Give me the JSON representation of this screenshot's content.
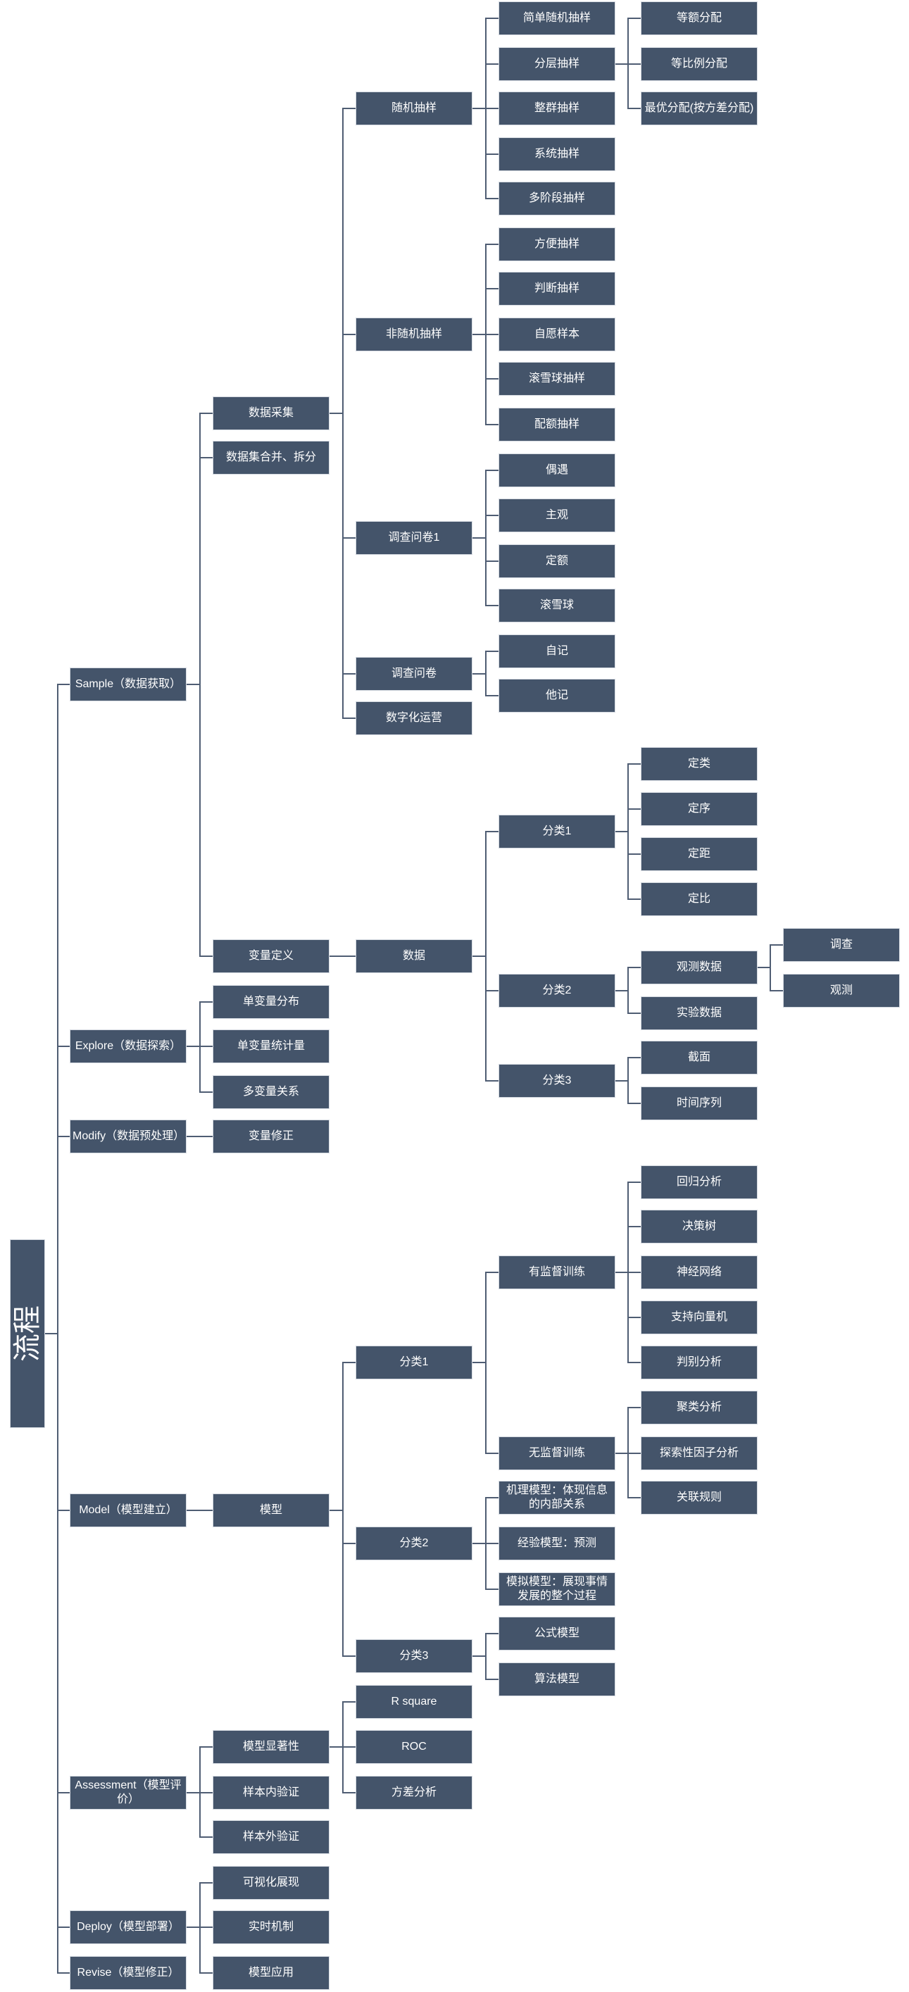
{
  "colors": {
    "box": "#44546A",
    "text": "#FFFFFF",
    "line": "#4F5D73"
  },
  "tree": {
    "label": "流程",
    "children": [
      {
        "label": "Sample（数据获取）",
        "children": [
          {
            "label": "数据采集",
            "children": [
              {
                "label": "随机抽样",
                "children": [
                  {
                    "label": "简单随机抽样"
                  },
                  {
                    "label": "分层抽样",
                    "children": [
                      {
                        "label": "等额分配"
                      },
                      {
                        "label": "等比例分配"
                      },
                      {
                        "label": "最优分配(按方差分配)"
                      }
                    ]
                  },
                  {
                    "label": "整群抽样"
                  },
                  {
                    "label": "系统抽样"
                  },
                  {
                    "label": "多阶段抽样"
                  }
                ]
              },
              {
                "label": "非随机抽样",
                "children": [
                  {
                    "label": "方便抽样"
                  },
                  {
                    "label": "判断抽样"
                  },
                  {
                    "label": "自愿样本"
                  },
                  {
                    "label": "滚雪球抽样"
                  },
                  {
                    "label": "配额抽样"
                  }
                ]
              },
              {
                "label": "调查问卷1",
                "children": [
                  {
                    "label": "偶遇"
                  },
                  {
                    "label": "主观"
                  },
                  {
                    "label": "定额"
                  },
                  {
                    "label": "滚雪球"
                  }
                ]
              },
              {
                "label": "调查问卷",
                "children": [
                  {
                    "label": "自记"
                  },
                  {
                    "label": "他记"
                  }
                ]
              },
              {
                "label": "数字化运营"
              }
            ]
          },
          {
            "label": "数据集合并、拆分"
          },
          {
            "label": "变量定义",
            "children": [
              {
                "label": "数据",
                "children": [
                  {
                    "label": "分类1",
                    "children": [
                      {
                        "label": "定类"
                      },
                      {
                        "label": "定序"
                      },
                      {
                        "label": "定距"
                      },
                      {
                        "label": "定比"
                      }
                    ]
                  },
                  {
                    "label": "分类2",
                    "children": [
                      {
                        "label": "观测数据",
                        "children": [
                          {
                            "label": "调查"
                          },
                          {
                            "label": "观测"
                          }
                        ]
                      },
                      {
                        "label": "实验数据"
                      }
                    ]
                  },
                  {
                    "label": "分类3",
                    "children": [
                      {
                        "label": "截面"
                      },
                      {
                        "label": "时间序列"
                      }
                    ]
                  }
                ]
              }
            ]
          }
        ]
      },
      {
        "label": "Explore（数据探索）",
        "children": [
          {
            "label": "单变量分布"
          },
          {
            "label": "单变量统计量"
          },
          {
            "label": "多变量关系"
          }
        ]
      },
      {
        "label": "Modify（数据预处理）",
        "children": [
          {
            "label": "变量修正"
          }
        ]
      },
      {
        "label": "Model（模型建立）",
        "children": [
          {
            "label": "模型",
            "children": [
              {
                "label": "分类1",
                "children": [
                  {
                    "label": "有监督训练",
                    "children": [
                      {
                        "label": "回归分析"
                      },
                      {
                        "label": "决策树"
                      },
                      {
                        "label": "神经网络"
                      },
                      {
                        "label": "支持向量机"
                      },
                      {
                        "label": "判别分析"
                      }
                    ]
                  },
                  {
                    "label": "无监督训练",
                    "children": [
                      {
                        "label": "聚类分析"
                      },
                      {
                        "label": "探索性因子分析"
                      },
                      {
                        "label": "关联规则"
                      }
                    ]
                  }
                ]
              },
              {
                "label": "分类2",
                "children": [
                  {
                    "label": "机理模型：体现信息的内部关系"
                  },
                  {
                    "label": "经验模型：预测"
                  },
                  {
                    "label": "模拟模型：展现事情发展的整个过程"
                  }
                ]
              },
              {
                "label": "分类3",
                "children": [
                  {
                    "label": "公式模型"
                  },
                  {
                    "label": "算法模型"
                  }
                ]
              }
            ]
          }
        ]
      },
      {
        "label": "Assessment（模型评价）",
        "children": [
          {
            "label": "模型显著性",
            "children": [
              {
                "label": "R square"
              },
              {
                "label": "ROC"
              },
              {
                "label": "方差分析"
              }
            ]
          },
          {
            "label": "样本内验证"
          },
          {
            "label": "样本外验证"
          }
        ]
      },
      {
        "label": "Deploy（模型部署）",
        "children": [
          {
            "label": "可视化展现"
          },
          {
            "label": "实时机制"
          },
          {
            "label": "模型应用"
          }
        ]
      },
      {
        "label": "Revise（模型修正）"
      }
    ]
  }
}
